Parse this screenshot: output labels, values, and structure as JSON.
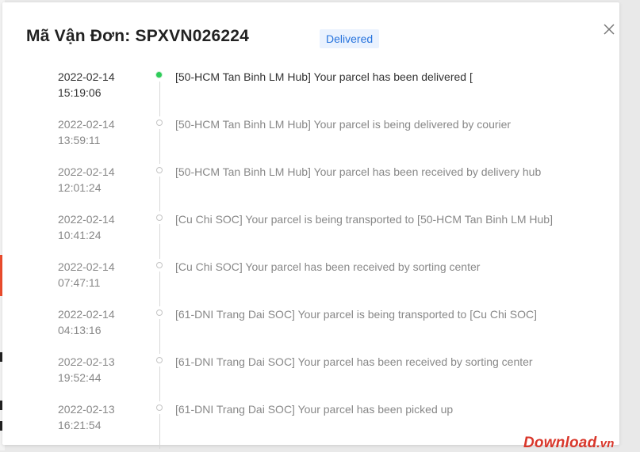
{
  "dialog": {
    "title": "Mã Vận Đơn: SPXVN026224",
    "status_badge": "Delivered",
    "close_icon": "close-icon"
  },
  "events": [
    {
      "date": "2022-02-14",
      "time": "15:19:06",
      "text": "[50-HCM Tan Binh LM Hub] Your parcel has been delivered [",
      "active": true
    },
    {
      "date": "2022-02-14",
      "time": "13:59:11",
      "text": "[50-HCM Tan Binh LM Hub] Your parcel is being delivered by courier",
      "active": false
    },
    {
      "date": "2022-02-14",
      "time": "12:01:24",
      "text": "[50-HCM Tan Binh LM Hub] Your parcel has been received by delivery hub",
      "active": false
    },
    {
      "date": "2022-02-14",
      "time": "10:41:24",
      "text": "[Cu Chi SOC] Your parcel is being transported to [50-HCM Tan Binh LM Hub]",
      "active": false
    },
    {
      "date": "2022-02-14",
      "time": "07:47:11",
      "text": "[Cu Chi SOC] Your parcel has been received by sorting center",
      "active": false
    },
    {
      "date": "2022-02-14",
      "time": "04:13:16",
      "text": "[61-DNI Trang Dai SOC] Your parcel is being transported to [Cu Chi SOC]",
      "active": false
    },
    {
      "date": "2022-02-13",
      "time": "19:52:44",
      "text": "[61-DNI Trang Dai SOC] Your parcel has been received by sorting center",
      "active": false
    },
    {
      "date": "2022-02-13",
      "time": "16:21:54",
      "text": "[61-DNI Trang Dai SOC] Your parcel has been picked up",
      "active": false
    }
  ],
  "watermark": {
    "brand": "Download",
    "suffix": ".vn"
  },
  "colors": {
    "active_dot": "#2ecc59",
    "badge_text": "#2673dd",
    "badge_bg": "#eaf2fe",
    "watermark": "#d9372b"
  }
}
